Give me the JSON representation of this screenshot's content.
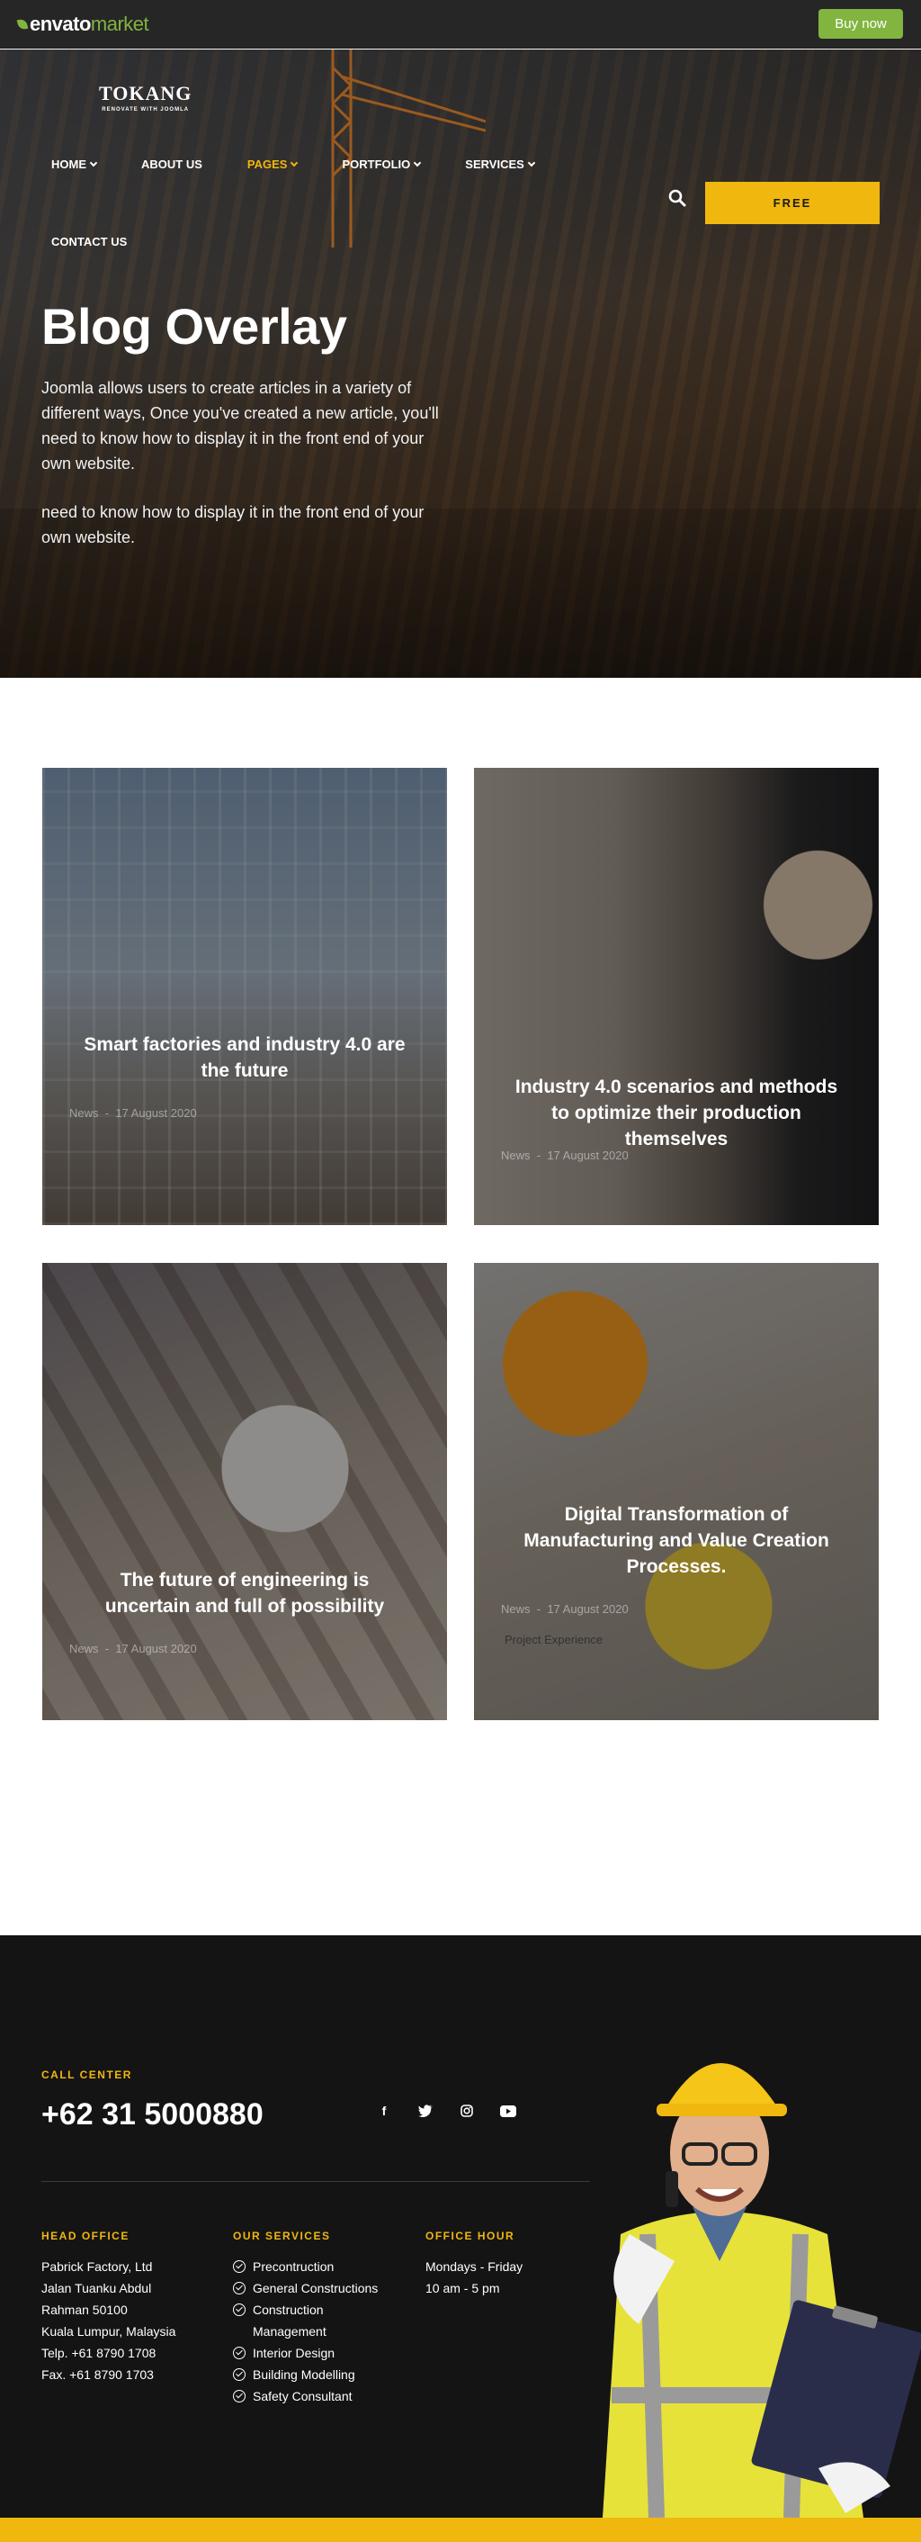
{
  "envato": {
    "logo_envato": "envato",
    "logo_market": "market",
    "buy_now": "Buy now",
    "accent": "#82b440"
  },
  "brand": {
    "name": "TOKANG",
    "tagline": "RENOVATE WITH JOOMLA"
  },
  "nav": {
    "items": [
      {
        "label": "HOME",
        "dropdown": true
      },
      {
        "label": "ABOUT US",
        "dropdown": false
      },
      {
        "label": "PAGES",
        "dropdown": true
      },
      {
        "label": "PORTFOLIO",
        "dropdown": true
      },
      {
        "label": "SERVICES",
        "dropdown": true
      }
    ],
    "contact": "CONTACT US",
    "active": "PAGES",
    "search_icon": "search-icon",
    "free_button": "FREE"
  },
  "hero": {
    "title": "Blog Overlay",
    "description": "Joomla allows users to create articles in a variety of different ways, Once you've created a new article, you'll need to know how to display it in the front end of your own website.",
    "description_repeat": "need to know how to display it in the front end of your own website."
  },
  "posts": [
    {
      "title": "Smart factories and industry 4.0 are the future",
      "category": "News",
      "date": "17 August 2020"
    },
    {
      "title": "Industry 4.0 scenarios and methods to optimize their production themselves",
      "category": "News",
      "date": "17 August 2020"
    },
    {
      "title": "The future of engineering is uncertain and full of possibility",
      "category": "News",
      "date": "17 August 2020"
    },
    {
      "title": "Digital Transformation of Manufacturing and Value Creation Processes.",
      "category": "News",
      "date": "17 August 2020",
      "extra": "Project Experience"
    }
  ],
  "footer": {
    "call_center_label": "CALL CENTER",
    "phone": "+62 31 5000880",
    "socials": [
      "facebook-icon",
      "twitter-icon",
      "instagram-icon",
      "youtube-icon"
    ],
    "head_office_label": "HEAD OFFICE",
    "head_office_lines": [
      "Pabrick Factory, Ltd",
      "Jalan Tuanku Abdul",
      "Rahman 50100",
      "Kuala Lumpur, Malaysia",
      "Telp. +61 8790 1708",
      "Fax. +61 8790 1703"
    ],
    "services_label": "OUR SERVICES",
    "services": [
      "Precontruction",
      "General Constructions",
      "Construction Management",
      "Interior Design",
      "Building Modelling",
      "Safety Consultant"
    ],
    "office_hour_label": "OFFICE HOUR",
    "office_hours": [
      "Mondays - Friday",
      "10 am - 5 pm"
    ]
  },
  "colors": {
    "accent_yellow": "#f0b70f",
    "footer_bg": "#141414"
  }
}
